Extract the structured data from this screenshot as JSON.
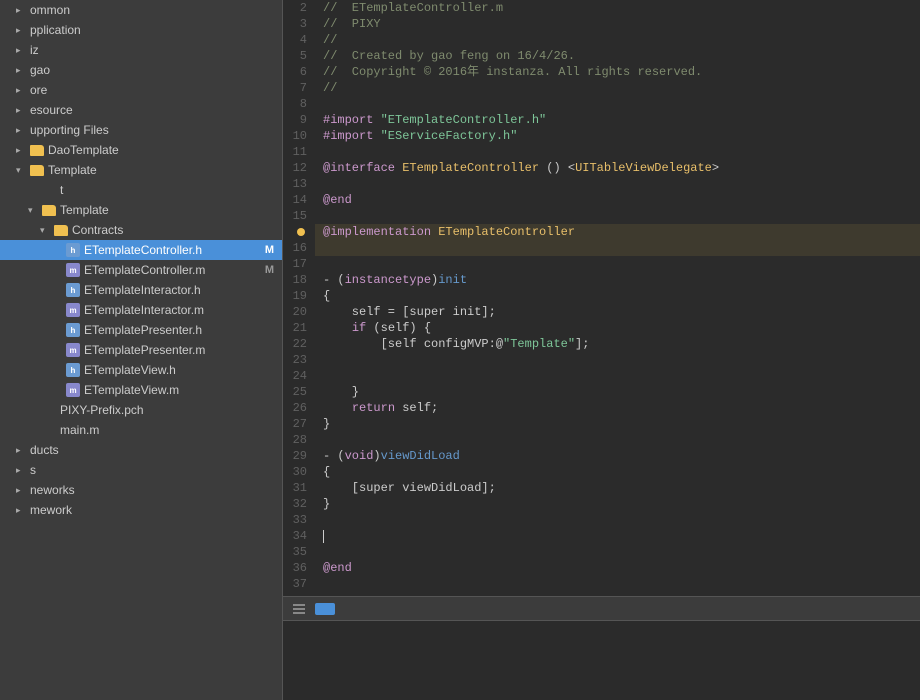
{
  "sidebar": {
    "items": [
      {
        "id": "common",
        "label": "ommon",
        "indent": 1,
        "type": "group",
        "arrow": "closed"
      },
      {
        "id": "application",
        "label": "pplication",
        "indent": 1,
        "type": "group",
        "arrow": "closed"
      },
      {
        "id": "iz",
        "label": "iz",
        "indent": 1,
        "type": "group",
        "arrow": "closed"
      },
      {
        "id": "gao",
        "label": "gao",
        "indent": 1,
        "type": "group",
        "arrow": "closed"
      },
      {
        "id": "ore",
        "label": "ore",
        "indent": 1,
        "type": "group",
        "arrow": "closed"
      },
      {
        "id": "esource",
        "label": "esource",
        "indent": 1,
        "type": "group",
        "arrow": "closed"
      },
      {
        "id": "supporting",
        "label": "upporting Files",
        "indent": 1,
        "type": "group",
        "arrow": "closed"
      },
      {
        "id": "daotemplate",
        "label": "DaoTemplate",
        "indent": 1,
        "type": "folder",
        "arrow": "closed"
      },
      {
        "id": "template",
        "label": "Template",
        "indent": 1,
        "type": "folder",
        "arrow": "open"
      },
      {
        "id": "t",
        "label": "t",
        "indent": 2,
        "type": "file-plain"
      },
      {
        "id": "contracts-folder",
        "label": "Template",
        "indent": 2,
        "type": "folder",
        "arrow": "open"
      },
      {
        "id": "contracts",
        "label": "Contracts",
        "indent": 3,
        "type": "folder",
        "arrow": "open"
      },
      {
        "id": "ETemplateController-h",
        "label": "ETemplateController.h",
        "indent": 4,
        "type": "file-h",
        "badge": "M",
        "selected": true
      },
      {
        "id": "ETemplateController-m",
        "label": "ETemplateController.m",
        "indent": 4,
        "type": "file-m",
        "badge": "M"
      },
      {
        "id": "ETemplateInteractor-h",
        "label": "ETemplateInteractor.h",
        "indent": 4,
        "type": "file-h"
      },
      {
        "id": "ETemplateInteractor-m",
        "label": "ETemplateInteractor.m",
        "indent": 4,
        "type": "file-m"
      },
      {
        "id": "ETemplatePresenter-h",
        "label": "ETemplatePresenter.h",
        "indent": 4,
        "type": "file-h"
      },
      {
        "id": "ETemplatePresenter-m",
        "label": "ETemplatePresenter.m",
        "indent": 4,
        "type": "file-m"
      },
      {
        "id": "ETemplateView-h",
        "label": "ETemplateView.h",
        "indent": 4,
        "type": "file-h"
      },
      {
        "id": "ETemplateView-m",
        "label": "ETemplateView.m",
        "indent": 4,
        "type": "file-m"
      },
      {
        "id": "pixy-prefix",
        "label": "PIXY-Prefix.pch",
        "indent": 2,
        "type": "file-plain"
      },
      {
        "id": "main-m",
        "label": "main.m",
        "indent": 2,
        "type": "file-plain"
      },
      {
        "id": "ducts",
        "label": "ducts",
        "indent": 1,
        "type": "group",
        "arrow": "closed"
      },
      {
        "id": "s",
        "label": "s",
        "indent": 1,
        "type": "group",
        "arrow": "closed"
      },
      {
        "id": "neworks",
        "label": "neworks",
        "indent": 1,
        "type": "group",
        "arrow": "closed"
      },
      {
        "id": "mework",
        "label": "mework",
        "indent": 1,
        "type": "group",
        "arrow": "closed"
      }
    ]
  },
  "code": {
    "lines": [
      {
        "num": 2,
        "tokens": [
          {
            "text": "//  ETemplateController.m",
            "class": "c-comment"
          }
        ]
      },
      {
        "num": 3,
        "tokens": [
          {
            "text": "//  PIXY",
            "class": "c-comment"
          }
        ]
      },
      {
        "num": 4,
        "tokens": [
          {
            "text": "//",
            "class": "c-comment"
          }
        ]
      },
      {
        "num": 5,
        "tokens": [
          {
            "text": "//  Created by gao feng on 16/4/26.",
            "class": "c-comment"
          }
        ]
      },
      {
        "num": 6,
        "tokens": [
          {
            "text": "//  Copyright © 2016年 instanza. All rights reserved.",
            "class": "c-comment"
          }
        ]
      },
      {
        "num": 7,
        "tokens": [
          {
            "text": "//",
            "class": "c-comment"
          }
        ]
      },
      {
        "num": 8,
        "tokens": [
          {
            "text": "",
            "class": ""
          }
        ]
      },
      {
        "num": 9,
        "tokens": [
          {
            "text": "#import ",
            "class": "c-import"
          },
          {
            "text": "\"ETemplateController.h\"",
            "class": "c-string"
          }
        ]
      },
      {
        "num": 10,
        "tokens": [
          {
            "text": "#import ",
            "class": "c-import"
          },
          {
            "text": "\"EServiceFactory.h\"",
            "class": "c-string"
          }
        ]
      },
      {
        "num": 11,
        "tokens": [
          {
            "text": "",
            "class": ""
          }
        ]
      },
      {
        "num": 12,
        "tokens": [
          {
            "text": "@interface ",
            "class": "c-at"
          },
          {
            "text": "ETemplateController",
            "class": "c-class"
          },
          {
            "text": " () <",
            "class": ""
          },
          {
            "text": "UITableViewDelegate",
            "class": "c-protocol"
          },
          {
            "text": ">",
            "class": ""
          }
        ]
      },
      {
        "num": 13,
        "tokens": [
          {
            "text": "",
            "class": ""
          }
        ]
      },
      {
        "num": 14,
        "tokens": [
          {
            "text": "@end",
            "class": "c-at"
          }
        ]
      },
      {
        "num": 15,
        "tokens": [
          {
            "text": "",
            "class": ""
          }
        ]
      },
      {
        "num": 16,
        "tokens": [
          {
            "text": "@implementation ",
            "class": "c-at"
          },
          {
            "text": "ETemplateController",
            "class": "c-class"
          },
          {
            "text": "",
            "class": ""
          }
        ],
        "warning": true
      },
      {
        "num": 17,
        "tokens": [
          {
            "text": "",
            "class": ""
          }
        ]
      },
      {
        "num": 18,
        "tokens": [
          {
            "text": "- (",
            "class": ""
          },
          {
            "text": "instancetype",
            "class": "c-keyword"
          },
          {
            "text": ")",
            "class": ""
          },
          {
            "text": "init",
            "class": "c-method"
          }
        ]
      },
      {
        "num": 19,
        "tokens": [
          {
            "text": "{",
            "class": ""
          }
        ]
      },
      {
        "num": 20,
        "tokens": [
          {
            "text": "    self = [super init];",
            "class": ""
          }
        ]
      },
      {
        "num": 21,
        "tokens": [
          {
            "text": "    ",
            "class": ""
          },
          {
            "text": "if",
            "class": "c-keyword"
          },
          {
            "text": " (self) {",
            "class": ""
          }
        ]
      },
      {
        "num": 22,
        "tokens": [
          {
            "text": "        [self configMVP:@",
            "class": ""
          },
          {
            "text": "\"Template\"",
            "class": "c-string"
          },
          {
            "text": "];",
            "class": ""
          }
        ]
      },
      {
        "num": 23,
        "tokens": [
          {
            "text": "",
            "class": ""
          }
        ]
      },
      {
        "num": 24,
        "tokens": [
          {
            "text": "",
            "class": ""
          }
        ]
      },
      {
        "num": 25,
        "tokens": [
          {
            "text": "    }",
            "class": ""
          }
        ]
      },
      {
        "num": 26,
        "tokens": [
          {
            "text": "    ",
            "class": ""
          },
          {
            "text": "return",
            "class": "c-keyword"
          },
          {
            "text": " self;",
            "class": ""
          }
        ]
      },
      {
        "num": 27,
        "tokens": [
          {
            "text": "}",
            "class": ""
          }
        ]
      },
      {
        "num": 28,
        "tokens": [
          {
            "text": "",
            "class": ""
          }
        ]
      },
      {
        "num": 29,
        "tokens": [
          {
            "text": "- (",
            "class": ""
          },
          {
            "text": "void",
            "class": "c-keyword"
          },
          {
            "text": ")",
            "class": ""
          },
          {
            "text": "viewDidLoad",
            "class": "c-method"
          }
        ]
      },
      {
        "num": 30,
        "tokens": [
          {
            "text": "{",
            "class": ""
          }
        ]
      },
      {
        "num": 31,
        "tokens": [
          {
            "text": "    [super viewDidLoad];",
            "class": ""
          }
        ]
      },
      {
        "num": 32,
        "tokens": [
          {
            "text": "}",
            "class": ""
          }
        ]
      },
      {
        "num": 33,
        "tokens": [
          {
            "text": "",
            "class": ""
          }
        ]
      },
      {
        "num": 34,
        "tokens": [
          {
            "text": "",
            "class": ""
          }
        ],
        "cursor": true
      },
      {
        "num": 35,
        "tokens": [
          {
            "text": "",
            "class": ""
          }
        ]
      },
      {
        "num": 36,
        "tokens": [
          {
            "text": "@end",
            "class": "c-at"
          }
        ]
      },
      {
        "num": 37,
        "tokens": [
          {
            "text": "",
            "class": ""
          }
        ]
      }
    ]
  },
  "bottom_bar": {
    "icon1": "list-icon",
    "icon2": "tag-icon"
  }
}
